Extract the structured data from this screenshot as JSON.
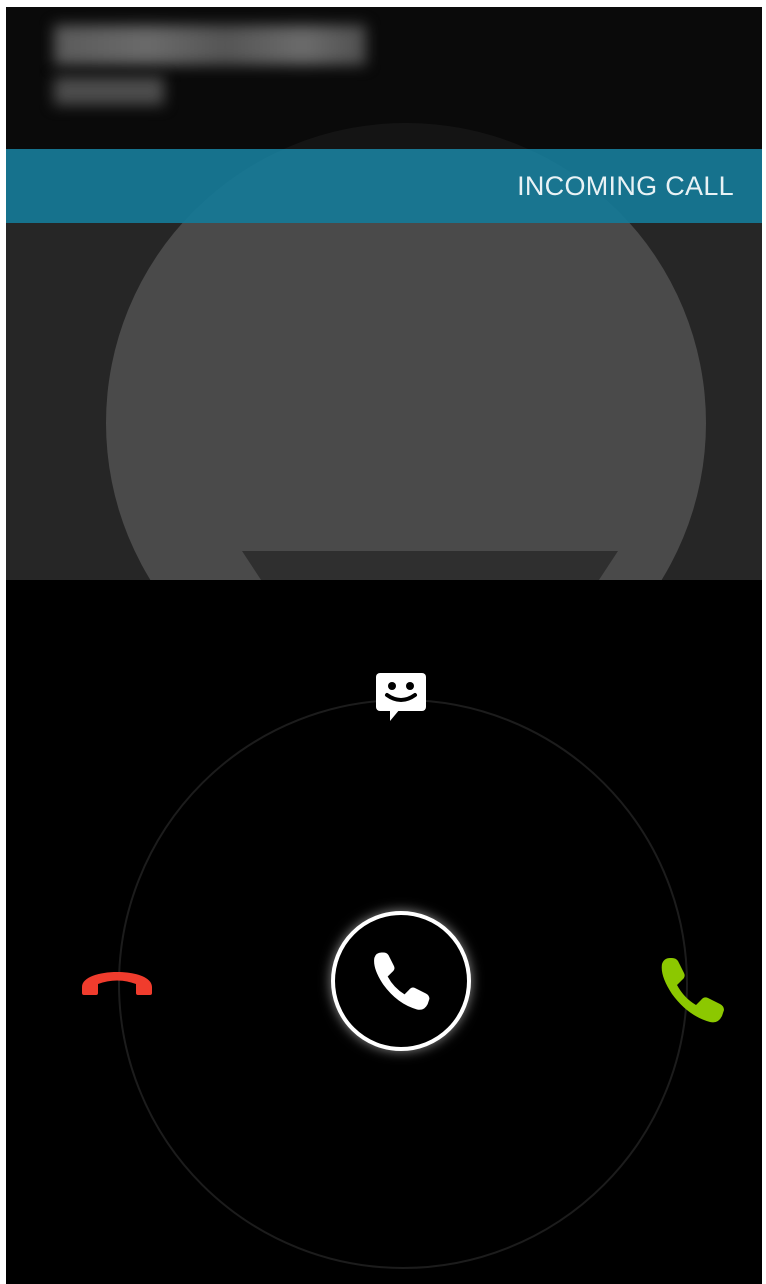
{
  "header": {
    "banner_label": "INCOMING CALL"
  },
  "caller": {
    "name_redacted": true,
    "photo": "default-avatar-silhouette"
  },
  "controls": {
    "center_handle_icon": "phone-icon",
    "decline_icon": "phone-hangup-icon",
    "answer_icon": "phone-answer-icon",
    "message_icon": "smiley-message-icon"
  },
  "colors": {
    "banner": "#1578A0",
    "decline": "#F03C2D",
    "answer": "#8CC800",
    "handle": "#FFFFFF"
  }
}
